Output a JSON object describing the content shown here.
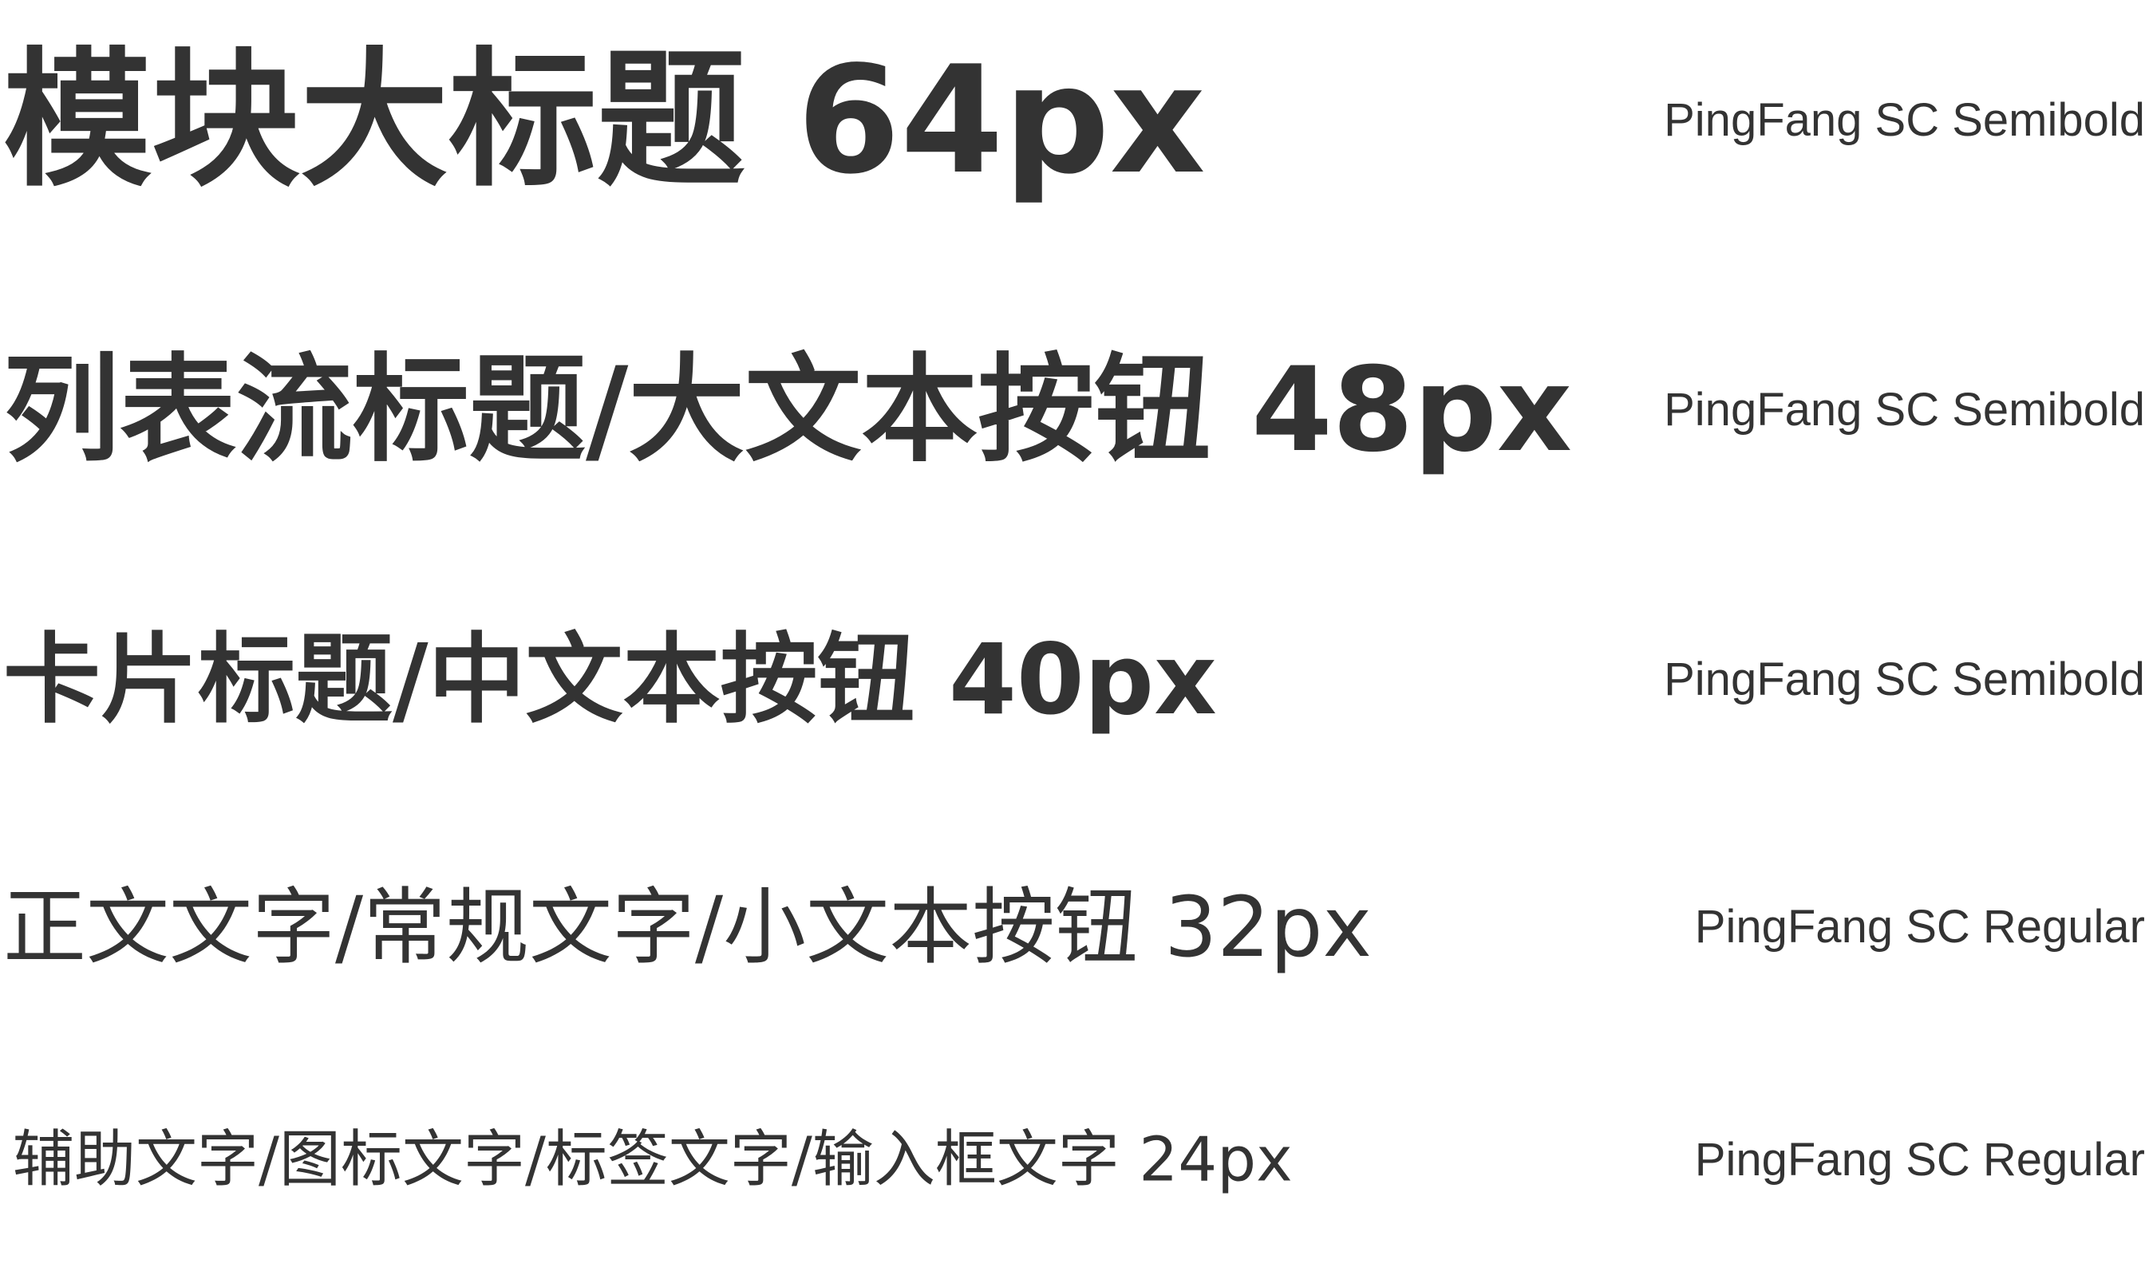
{
  "rows": [
    {
      "sample": "模块大标题 64px",
      "font": "PingFang SC Semibold"
    },
    {
      "sample": "列表流标题/大文本按钮 48px",
      "font": "PingFang SC Semibold"
    },
    {
      "sample": "卡片标题/中文本按钮 40px",
      "font": "PingFang SC Semibold"
    },
    {
      "sample": "正文文字/常规文字/小文本按钮 32px",
      "font": "PingFang SC Regular"
    },
    {
      "sample": "辅助文字/图标文字/标签文字/输入框文字 24px",
      "font": "PingFang SC Regular"
    }
  ],
  "colors": {
    "text": "#333333",
    "background": "#ffffff"
  }
}
